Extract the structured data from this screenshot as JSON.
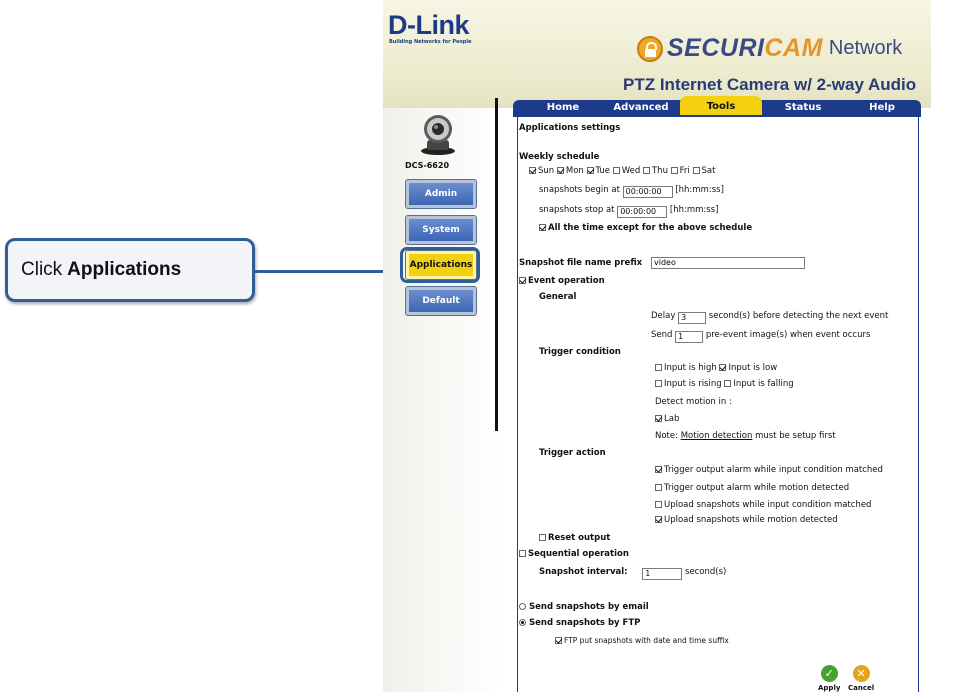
{
  "callout": {
    "prefix": "Click",
    "target": "Applications"
  },
  "header": {
    "logo": "D-Link",
    "tagline": "Building Networks for People",
    "brand_securi": "SECURI",
    "brand_cam": "CAM",
    "brand_network": "Network",
    "product": "PTZ Internet Camera w/ 2-way Audio"
  },
  "sidebar": {
    "model": "DCS-6620",
    "items": [
      {
        "label": "Admin"
      },
      {
        "label": "System"
      },
      {
        "label": "Applications"
      },
      {
        "label": "Default"
      }
    ]
  },
  "tabs": [
    {
      "label": "Home"
    },
    {
      "label": "Advanced"
    },
    {
      "label": "Tools"
    },
    {
      "label": "Status"
    },
    {
      "label": "Help"
    }
  ],
  "form": {
    "section_title": "Applications settings",
    "weekly_schedule": "Weekly schedule",
    "days": [
      {
        "label": "Sun",
        "checked": true
      },
      {
        "label": "Mon",
        "checked": true
      },
      {
        "label": "Tue",
        "checked": true
      },
      {
        "label": "Wed",
        "checked": false
      },
      {
        "label": "Thu",
        "checked": false
      },
      {
        "label": "Fri",
        "checked": false
      },
      {
        "label": "Sat",
        "checked": false
      }
    ],
    "begin_label": "snapshots begin at",
    "begin_value": "00:00:00",
    "stop_label": "snapshots stop at",
    "stop_value": "00:00:00",
    "time_hint": "[hh:mm:ss]",
    "all_time": "All the time except for the above schedule",
    "prefix_label": "Snapshot file name prefix",
    "prefix_value": "video",
    "event_operation": "Event operation",
    "general": "General",
    "delay_label": "Delay",
    "delay_value": "3",
    "delay_suffix": "second(s) before detecting the next event",
    "send_label": "Send",
    "send_value": "1",
    "send_suffix": "pre-event image(s) when event occurs",
    "trigger_condition": "Trigger condition",
    "input_high": "Input is high",
    "input_low": "Input is low",
    "input_rising": "Input is rising",
    "input_falling": "Input is falling",
    "detect_motion": "Detect motion in :",
    "lab": "Lab",
    "note_prefix": "Note:",
    "note_link": "Motion detection",
    "note_suffix": "must be setup first",
    "trigger_action": "Trigger action",
    "actions": [
      {
        "label": "Trigger output alarm while input condition matched",
        "checked": true
      },
      {
        "label": "Trigger output alarm while motion detected",
        "checked": false
      },
      {
        "label": "Upload snapshots while input condition matched",
        "checked": false
      },
      {
        "label": "Upload snapshots while motion detected",
        "checked": true
      }
    ],
    "reset_output": "Reset output",
    "sequential": "Sequential operation",
    "interval_label": "Snapshot interval:",
    "interval_value": "1",
    "interval_suffix": "second(s)",
    "send_email": "Send snapshots by email",
    "send_ftp": "Send snapshots by FTP",
    "ftp_suffix": "FTP put snapshots with date and time suffix",
    "apply": "Apply",
    "cancel": "Cancel"
  },
  "colors": {
    "tab_bar": "#1d3b8a",
    "active": "#f3d111",
    "callout_border": "#2f5f95"
  }
}
